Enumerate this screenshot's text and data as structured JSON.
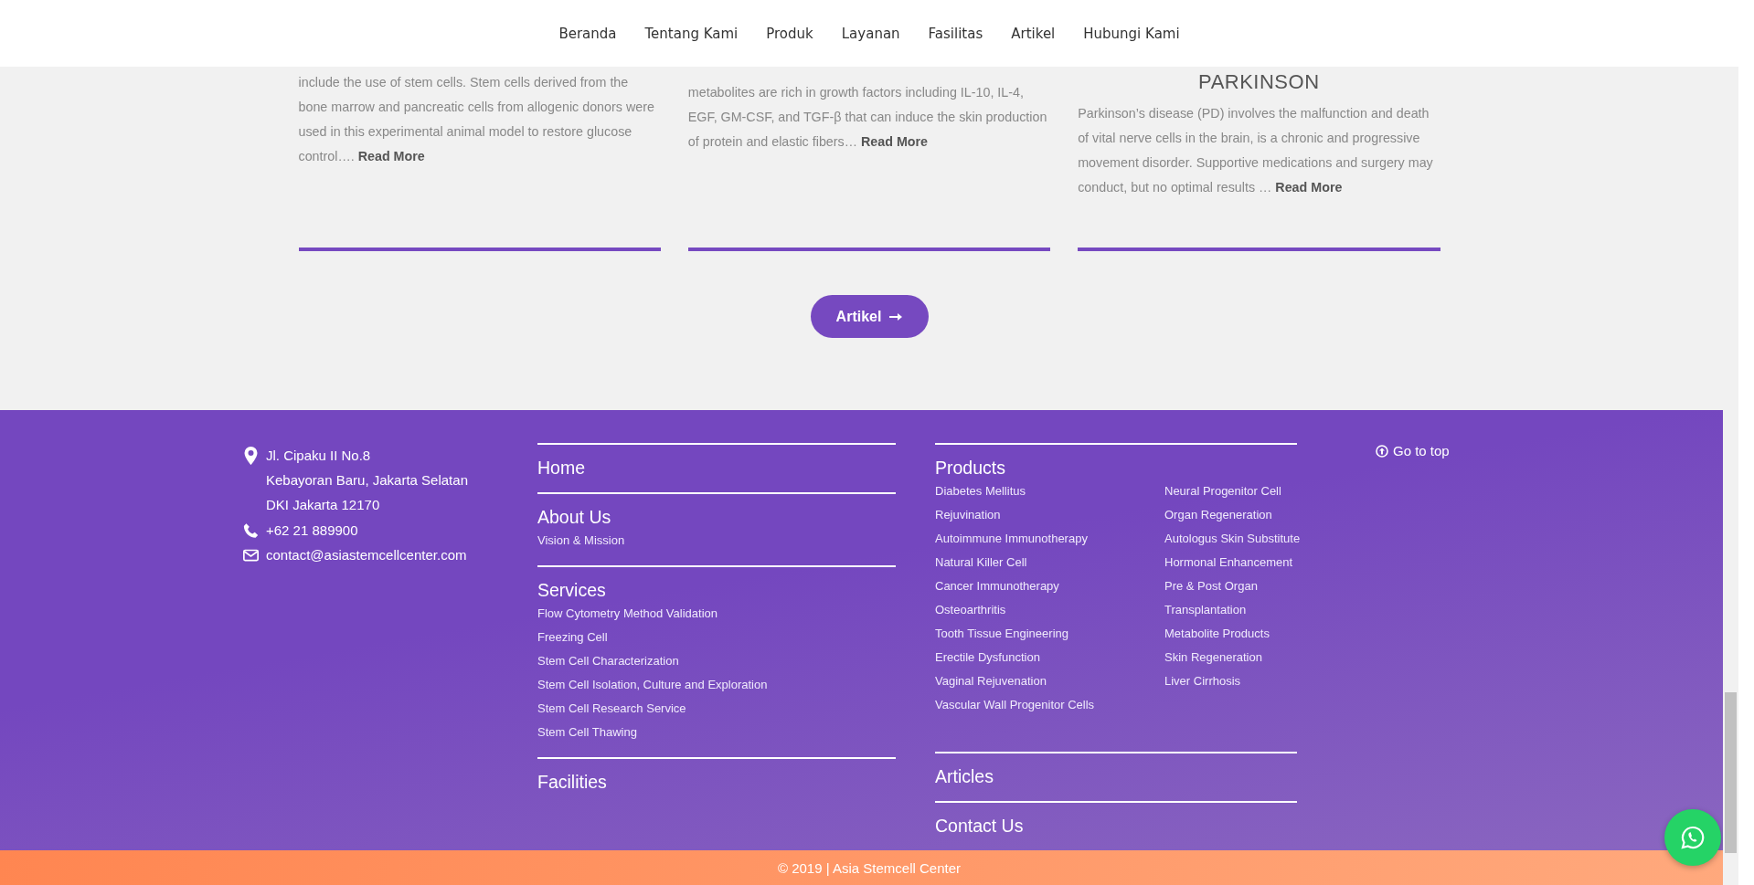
{
  "nav": {
    "items": [
      "Beranda",
      "Tentang Kami",
      "Produk",
      "Layanan",
      "Fasilitas",
      "Artikel",
      "Hubungi Kami"
    ]
  },
  "articles": [
    {
      "excerpt": "include the use of stem cells. Stem cells derived from the bone marrow and pancreatic cells from allogenic donors were used in this experimental animal model to restore glucose control….",
      "read_more": "Read More"
    },
    {
      "excerpt": "metabolites are rich in growth factors including IL-10, IL-4, EGF, GM-CSF, and TGF-β that can induce the skin production of protein and elastic fibers…",
      "read_more": "Read More"
    },
    {
      "title": "PARKINSON",
      "excerpt": "Parkinson’s disease (PD) involves the malfunction and death of vital nerve cells in the brain, is a chronic and progressive movement disorder. Supportive medications and surgery may conduct, but no optimal results …",
      "read_more": "Read More"
    }
  ],
  "articles_button": "Artikel",
  "footer": {
    "contact": {
      "address_lines": [
        "Jl. Cipaku II No.8",
        "Kebayoran Baru, Jakarta Selatan",
        "DKI Jakarta 12170"
      ],
      "phone": "+62 21 889900",
      "email": "contact@asiastemcellcenter.com"
    },
    "menu": [
      {
        "heading": "Home"
      },
      {
        "heading": "About Us",
        "links": [
          "Vision & Mission"
        ]
      },
      {
        "heading": "Services",
        "links": [
          "Flow Cytometry Method Validation",
          "Freezing Cell",
          "Stem Cell Characterization",
          "Stem Cell Isolation, Culture and Exploration",
          "Stem Cell Research Service",
          "Stem Cell Thawing"
        ]
      },
      {
        "heading": "Facilities"
      }
    ],
    "products": {
      "heading": "Products",
      "links_left": [
        "Diabetes Mellitus",
        "Rejuvination",
        "Autoimmune Immunotherapy",
        "Natural Killer Cell",
        "Cancer Immunotherapy",
        "Osteoarthritis",
        "Tooth Tissue Engineering",
        "Erectile Dysfunction",
        "Vaginal Rejuvenation",
        "Vascular Wall Progenitor Cells"
      ],
      "links_right": [
        "Neural Progenitor Cell",
        "Organ Regeneration",
        "Autologus Skin Substitute",
        "Hormonal Enhancement",
        "Pre & Post Organ",
        "Transplantation",
        "Metabolite Products",
        "Skin Regeneration",
        "Liver Cirrhosis"
      ]
    },
    "more_menu": [
      {
        "heading": "Articles"
      },
      {
        "heading": "Contact Us"
      }
    ],
    "go_to_top": "Go to top"
  },
  "copyright": "© 2019 | Asia Stemcell Center"
}
